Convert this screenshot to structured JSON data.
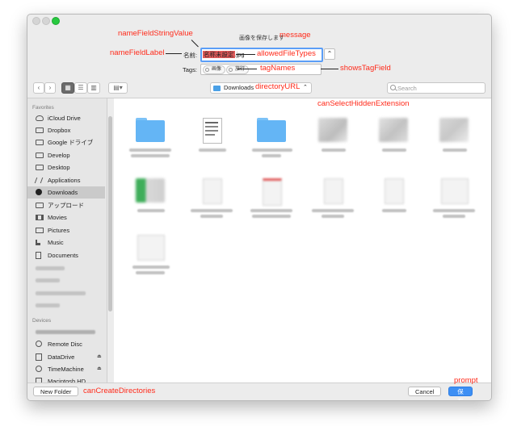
{
  "dialog": {
    "message": "画像を保存します",
    "name_label": "名前:",
    "name_value_selected": "名称未設定",
    "name_value_ext": ".jpg",
    "expand_glyph": "⌃",
    "tags_label": "Tags:",
    "tags": [
      "画像",
      "旅行"
    ]
  },
  "toolbar": {
    "back_glyph": "‹",
    "forward_glyph": "›",
    "directory": "Downloads",
    "search_placeholder": "Search"
  },
  "annotations": {
    "nameFieldStringValue": "nameFieldStringValue",
    "message": "message",
    "nameFieldLabel": "nameFieldLabel",
    "allowedFileTypes": "allowedFileTypes",
    "showsTagField": "showsTagField",
    "tagNames": "tagNames",
    "directoryURL": "directoryURL",
    "canSelectHiddenExtension": "canSelectHiddenExtension",
    "canCreateDirectories": "canCreateDirectories",
    "prompt": "prompt"
  },
  "sidebar": {
    "favorites_header": "Favorites",
    "devices_header": "Devices",
    "favorites": [
      {
        "label": "iCloud Drive",
        "icon": "cloud-icon"
      },
      {
        "label": "Dropbox",
        "icon": "folder-icon"
      },
      {
        "label": "Google ドライブ",
        "icon": "folder-icon"
      },
      {
        "label": "Develop",
        "icon": "folder-icon"
      },
      {
        "label": "Desktop",
        "icon": "desktop-icon"
      },
      {
        "label": "Applications",
        "icon": "applications-icon"
      },
      {
        "label": "Downloads",
        "icon": "downloads-icon",
        "selected": true
      },
      {
        "label": "アップロード",
        "icon": "folder-icon"
      },
      {
        "label": "Movies",
        "icon": "film-icon"
      },
      {
        "label": "Pictures",
        "icon": "camera-icon"
      },
      {
        "label": "Music",
        "icon": "music-icon"
      },
      {
        "label": "Documents",
        "icon": "document-icon"
      }
    ],
    "devices": [
      {
        "label": "Remote Disc",
        "icon": "disc-icon"
      },
      {
        "label": "DataDrive",
        "icon": "drive-icon",
        "eject": true
      },
      {
        "label": "TimeMachine",
        "icon": "clock-icon",
        "eject": true
      },
      {
        "label": "Macintosh HD",
        "icon": "drive-icon"
      }
    ],
    "eject_glyph": "⏏"
  },
  "bottom": {
    "new_folder": "New Folder",
    "cancel": "Cancel",
    "save": "保存"
  },
  "colors": {
    "accent": "#3d8ff4",
    "annotation": "#ff2a1a",
    "folder": "#64b5f5",
    "selection": "#e05a5a"
  }
}
